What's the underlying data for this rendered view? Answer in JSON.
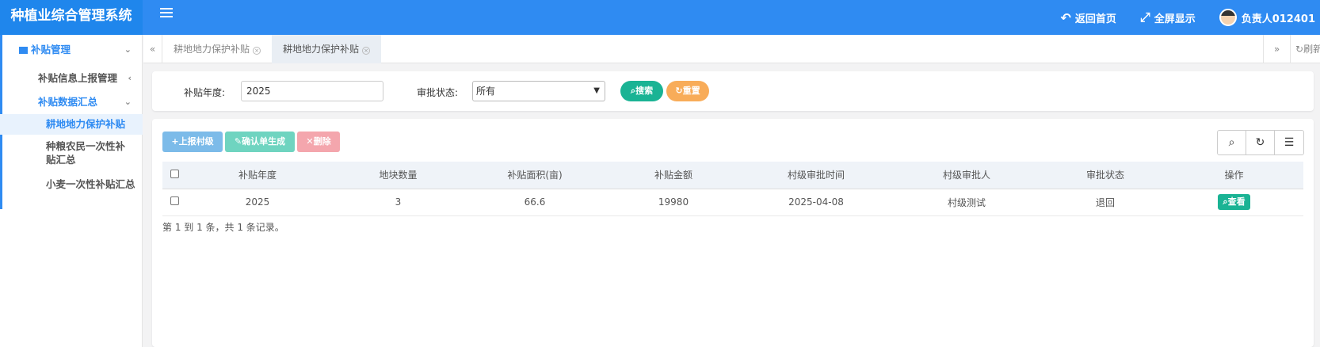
{
  "app": {
    "title": "种植业综合管理系统"
  },
  "header": {
    "back_home": "返回首页",
    "fullscreen": "全屏显示",
    "user_name": "负责人012401"
  },
  "sidebar": {
    "menu": "补贴管理",
    "sub1": "补贴信息上报管理",
    "sub2": "补贴数据汇总",
    "leaf1": "耕地地力保护补贴",
    "leaf2": "种粮农民一次性补贴汇总",
    "leaf3": "小麦一次性补贴汇总"
  },
  "tabs": [
    {
      "label": "耕地地力保护补贴"
    },
    {
      "label": "耕地地力保护补贴"
    }
  ],
  "tabs_right": {
    "refresh": "刷新"
  },
  "search": {
    "year_label": "补贴年度:",
    "year_value": "2025",
    "status_label": "审批状态:",
    "status_value": "所有",
    "search_btn": "搜索",
    "reset_btn": "重置"
  },
  "toolbar": {
    "report": "上报村级",
    "confirm": "确认单生成",
    "delete": "删除"
  },
  "table": {
    "headers": [
      "补贴年度",
      "地块数量",
      "补贴面积(亩)",
      "补贴金额",
      "村级审批时间",
      "村级审批人",
      "审批状态",
      "操作"
    ],
    "rows": [
      {
        "year": "2025",
        "plots": "3",
        "area": "66.6",
        "amount": "19980",
        "approve_time": "2025-04-08",
        "approver": "村级测试",
        "status": "退回",
        "action": "查看"
      }
    ]
  },
  "pager": {
    "summary": "第 1 到 1 条，共 1 条记录。"
  },
  "colors": {
    "primary": "#2f8bf2",
    "green": "#1ab394",
    "orange": "#f8ac59",
    "info": "#7cbbe9",
    "teal_light": "#6fd4c0",
    "red_light": "#f4a6ad"
  }
}
